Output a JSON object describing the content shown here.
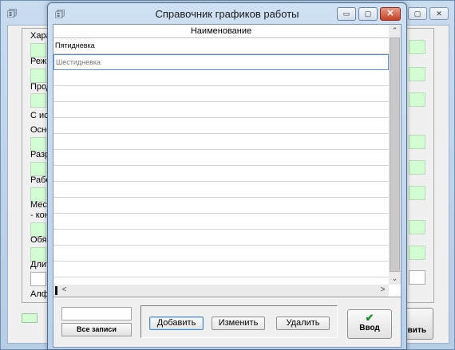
{
  "background_window": {
    "labels": [
      "Хара",
      "Режи",
      "Прод",
      "С исп",
      "Осно",
      "Разр",
      "Рабо",
      "Мест",
      "- кон",
      "Обяз",
      "Длит",
      "Алфа"
    ],
    "button_label": "вить",
    "controls": {
      "minimize": "▭",
      "maximize": "▢",
      "close": "✕"
    }
  },
  "dialog": {
    "title": "Справочник графиков работы",
    "controls": {
      "minimize": "▭",
      "maximize": "▢",
      "close": "✕"
    },
    "grid": {
      "column_header": "Наименование",
      "rows": [
        "Пятидневка",
        "Шестидневка",
        "",
        "",
        "",
        "",
        "",
        "",
        "",
        "",
        "",
        "",
        "",
        "",
        ""
      ]
    },
    "scroll": {
      "up": "⌃",
      "down": "⌄",
      "left": "<",
      "right": ">"
    },
    "filter_input_value": "",
    "all_records_label": "Все записи",
    "actions": {
      "add": "Добавить",
      "edit": "Изменить",
      "delete": "Удалить"
    },
    "enter": {
      "check": "✔",
      "label": "Ввод"
    }
  }
}
